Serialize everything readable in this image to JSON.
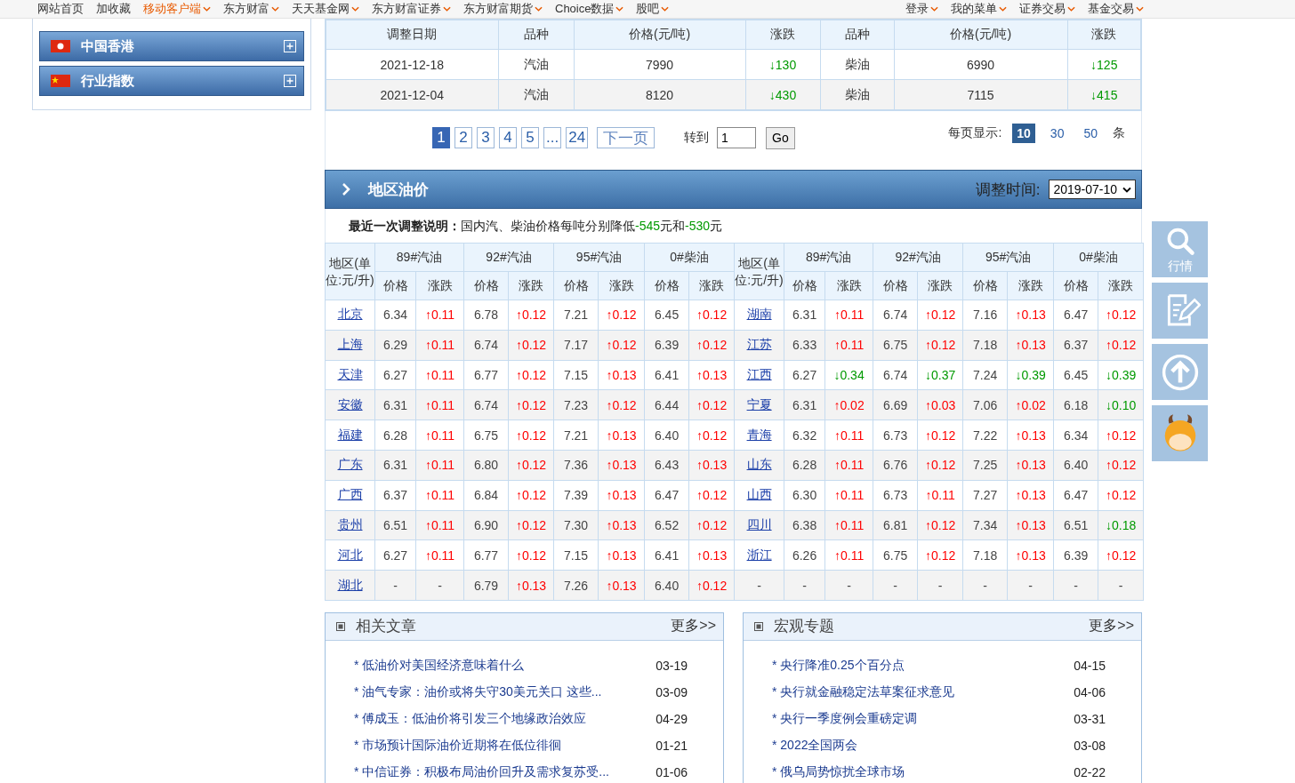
{
  "nav": {
    "left": [
      {
        "label": "网站首页",
        "caret": false,
        "highlight": false
      },
      {
        "label": "加收藏",
        "caret": false,
        "highlight": false
      },
      {
        "label": "移动客户端",
        "caret": true,
        "highlight": true
      },
      {
        "label": "东方财富",
        "caret": true,
        "highlight": false
      },
      {
        "label": "天天基金网",
        "caret": true,
        "highlight": false
      },
      {
        "label": "东方财富证券",
        "caret": true,
        "highlight": false
      },
      {
        "label": "东方财富期货",
        "caret": true,
        "highlight": false
      },
      {
        "label": "Choice数据",
        "caret": true,
        "highlight": false
      },
      {
        "label": "股吧",
        "caret": true,
        "highlight": false
      }
    ],
    "right": [
      {
        "label": "登录",
        "caret": true,
        "highlight": false
      },
      {
        "label": "我的菜单",
        "caret": true,
        "highlight": false
      },
      {
        "label": "证券交易",
        "caret": true,
        "highlight": false
      },
      {
        "label": "基金交易",
        "caret": true,
        "highlight": false
      }
    ]
  },
  "sidebar": {
    "items": [
      {
        "label": "中国香港",
        "kind": "hk"
      },
      {
        "label": "行业指数",
        "kind": "cn"
      }
    ]
  },
  "price_history": {
    "columns": [
      "调整日期",
      "品种",
      "价格(元/吨)",
      "涨跌",
      "品种",
      "价格(元/吨)",
      "涨跌"
    ],
    "rows": [
      {
        "cells": [
          {
            "text": "2021-12-18"
          },
          {
            "text": "汽油"
          },
          {
            "text": "7990"
          },
          {
            "text": "↓130",
            "kind": "down"
          },
          {
            "text": "柴油"
          },
          {
            "text": "6990"
          },
          {
            "text": "↓125",
            "kind": "down"
          }
        ]
      },
      {
        "cells": [
          {
            "text": "2021-12-04"
          },
          {
            "text": "汽油"
          },
          {
            "text": "8120"
          },
          {
            "text": "↓430",
            "kind": "down"
          },
          {
            "text": "柴油"
          },
          {
            "text": "7115"
          },
          {
            "text": "↓415",
            "kind": "down"
          }
        ]
      }
    ]
  },
  "pagination": {
    "pages": [
      {
        "label": "1",
        "selected": true
      },
      {
        "label": "2",
        "selected": false
      },
      {
        "label": "3",
        "selected": false
      },
      {
        "label": "4",
        "selected": false
      },
      {
        "label": "5",
        "selected": false
      },
      {
        "label": "...",
        "selected": false
      },
      {
        "label": "24",
        "selected": false
      }
    ],
    "next": "下一页",
    "goto_label": "转到",
    "goto_value": "1",
    "go": "Go",
    "per_page_label": "每页显示:",
    "per_page": [
      {
        "label": "10",
        "selected": true
      },
      {
        "label": "30",
        "selected": false
      },
      {
        "label": "50",
        "selected": false
      }
    ],
    "per_page_unit": "条"
  },
  "regional": {
    "title": "地区油价",
    "date_label": "调整时间:",
    "date_value": "2019-07-10",
    "note": {
      "label": "最近一次调整说明：",
      "parts": [
        {
          "text": "国内汽、柴油价格每吨分别降低",
          "kind": "plain"
        },
        {
          "text": "-545",
          "kind": "down"
        },
        {
          "text": "元和",
          "kind": "plain"
        },
        {
          "text": "-530",
          "kind": "down"
        },
        {
          "text": "元",
          "kind": "plain"
        }
      ]
    },
    "headers": [
      {
        "region": "地区(单位:元/升)",
        "fuels": [
          {
            "name": "89#汽油",
            "price": "价格",
            "change": "涨跌"
          },
          {
            "name": "92#汽油",
            "price": "价格",
            "change": "涨跌"
          },
          {
            "name": "95#汽油",
            "price": "价格",
            "change": "涨跌"
          },
          {
            "name": "0#柴油",
            "price": "价格",
            "change": "涨跌"
          }
        ]
      },
      {
        "region": "地区(单位:元/升)",
        "fuels": [
          {
            "name": "89#汽油",
            "price": "价格",
            "change": "涨跌"
          },
          {
            "name": "92#汽油",
            "price": "价格",
            "change": "涨跌"
          },
          {
            "name": "95#汽油",
            "price": "价格",
            "change": "涨跌"
          },
          {
            "name": "0#柴油",
            "price": "价格",
            "change": "涨跌"
          }
        ]
      }
    ],
    "left_rows": [
      {
        "region": "北京",
        "link": true,
        "prices": [
          "6.34",
          "6.78",
          "7.21",
          "6.45"
        ],
        "changes": [
          {
            "text": "↑0.11",
            "kind": "up"
          },
          {
            "text": "↑0.12",
            "kind": "up"
          },
          {
            "text": "↑0.12",
            "kind": "up"
          },
          {
            "text": "↑0.12",
            "kind": "up"
          }
        ]
      },
      {
        "region": "上海",
        "link": true,
        "prices": [
          "6.29",
          "6.74",
          "7.17",
          "6.39"
        ],
        "changes": [
          {
            "text": "↑0.11",
            "kind": "up"
          },
          {
            "text": "↑0.12",
            "kind": "up"
          },
          {
            "text": "↑0.12",
            "kind": "up"
          },
          {
            "text": "↑0.12",
            "kind": "up"
          }
        ]
      },
      {
        "region": "天津",
        "link": true,
        "prices": [
          "6.27",
          "6.77",
          "7.15",
          "6.41"
        ],
        "changes": [
          {
            "text": "↑0.11",
            "kind": "up"
          },
          {
            "text": "↑0.12",
            "kind": "up"
          },
          {
            "text": "↑0.13",
            "kind": "up"
          },
          {
            "text": "↑0.13",
            "kind": "up"
          }
        ]
      },
      {
        "region": "安徽",
        "link": true,
        "prices": [
          "6.31",
          "6.74",
          "7.23",
          "6.44"
        ],
        "changes": [
          {
            "text": "↑0.11",
            "kind": "up"
          },
          {
            "text": "↑0.12",
            "kind": "up"
          },
          {
            "text": "↑0.12",
            "kind": "up"
          },
          {
            "text": "↑0.12",
            "kind": "up"
          }
        ]
      },
      {
        "region": "福建",
        "link": true,
        "prices": [
          "6.28",
          "6.75",
          "7.21",
          "6.40"
        ],
        "changes": [
          {
            "text": "↑0.11",
            "kind": "up"
          },
          {
            "text": "↑0.12",
            "kind": "up"
          },
          {
            "text": "↑0.13",
            "kind": "up"
          },
          {
            "text": "↑0.12",
            "kind": "up"
          }
        ]
      },
      {
        "region": "广东",
        "link": true,
        "prices": [
          "6.31",
          "6.80",
          "7.36",
          "6.43"
        ],
        "changes": [
          {
            "text": "↑0.11",
            "kind": "up"
          },
          {
            "text": "↑0.12",
            "kind": "up"
          },
          {
            "text": "↑0.13",
            "kind": "up"
          },
          {
            "text": "↑0.13",
            "kind": "up"
          }
        ]
      },
      {
        "region": "广西",
        "link": true,
        "prices": [
          "6.37",
          "6.84",
          "7.39",
          "6.47"
        ],
        "changes": [
          {
            "text": "↑0.11",
            "kind": "up"
          },
          {
            "text": "↑0.12",
            "kind": "up"
          },
          {
            "text": "↑0.13",
            "kind": "up"
          },
          {
            "text": "↑0.12",
            "kind": "up"
          }
        ]
      },
      {
        "region": "贵州",
        "link": true,
        "prices": [
          "6.51",
          "6.90",
          "7.30",
          "6.52"
        ],
        "changes": [
          {
            "text": "↑0.11",
            "kind": "up"
          },
          {
            "text": "↑0.12",
            "kind": "up"
          },
          {
            "text": "↑0.13",
            "kind": "up"
          },
          {
            "text": "↑0.12",
            "kind": "up"
          }
        ]
      },
      {
        "region": "河北",
        "link": true,
        "prices": [
          "6.27",
          "6.77",
          "7.15",
          "6.41"
        ],
        "changes": [
          {
            "text": "↑0.11",
            "kind": "up"
          },
          {
            "text": "↑0.12",
            "kind": "up"
          },
          {
            "text": "↑0.13",
            "kind": "up"
          },
          {
            "text": "↑0.13",
            "kind": "up"
          }
        ]
      },
      {
        "region": "湖北",
        "link": true,
        "prices": [
          "-",
          "6.79",
          "7.26",
          "6.40"
        ],
        "changes": [
          {
            "text": "-",
            "kind": "flat"
          },
          {
            "text": "↑0.13",
            "kind": "up"
          },
          {
            "text": "↑0.13",
            "kind": "up"
          },
          {
            "text": "↑0.12",
            "kind": "up"
          }
        ]
      }
    ],
    "right_rows": [
      {
        "region": "湖南",
        "link": true,
        "prices": [
          "6.31",
          "6.74",
          "7.16",
          "6.47"
        ],
        "changes": [
          {
            "text": "↑0.11",
            "kind": "up"
          },
          {
            "text": "↑0.12",
            "kind": "up"
          },
          {
            "text": "↑0.13",
            "kind": "up"
          },
          {
            "text": "↑0.12",
            "kind": "up"
          }
        ]
      },
      {
        "region": "江苏",
        "link": true,
        "prices": [
          "6.33",
          "6.75",
          "7.18",
          "6.37"
        ],
        "changes": [
          {
            "text": "↑0.11",
            "kind": "up"
          },
          {
            "text": "↑0.12",
            "kind": "up"
          },
          {
            "text": "↑0.13",
            "kind": "up"
          },
          {
            "text": "↑0.12",
            "kind": "up"
          }
        ]
      },
      {
        "region": "江西",
        "link": true,
        "prices": [
          "6.27",
          "6.74",
          "7.24",
          "6.45"
        ],
        "changes": [
          {
            "text": "↓0.34",
            "kind": "down"
          },
          {
            "text": "↓0.37",
            "kind": "down"
          },
          {
            "text": "↓0.39",
            "kind": "down"
          },
          {
            "text": "↓0.39",
            "kind": "down"
          }
        ]
      },
      {
        "region": "宁夏",
        "link": true,
        "prices": [
          "6.31",
          "6.69",
          "7.06",
          "6.18"
        ],
        "changes": [
          {
            "text": "↑0.02",
            "kind": "up"
          },
          {
            "text": "↑0.03",
            "kind": "up"
          },
          {
            "text": "↑0.02",
            "kind": "up"
          },
          {
            "text": "↓0.10",
            "kind": "down"
          }
        ]
      },
      {
        "region": "青海",
        "link": true,
        "prices": [
          "6.32",
          "6.73",
          "7.22",
          "6.34"
        ],
        "changes": [
          {
            "text": "↑0.11",
            "kind": "up"
          },
          {
            "text": "↑0.12",
            "kind": "up"
          },
          {
            "text": "↑0.13",
            "kind": "up"
          },
          {
            "text": "↑0.12",
            "kind": "up"
          }
        ]
      },
      {
        "region": "山东",
        "link": true,
        "prices": [
          "6.28",
          "6.76",
          "7.25",
          "6.40"
        ],
        "changes": [
          {
            "text": "↑0.11",
            "kind": "up"
          },
          {
            "text": "↑0.12",
            "kind": "up"
          },
          {
            "text": "↑0.13",
            "kind": "up"
          },
          {
            "text": "↑0.12",
            "kind": "up"
          }
        ]
      },
      {
        "region": "山西",
        "link": true,
        "prices": [
          "6.30",
          "6.73",
          "7.27",
          "6.47"
        ],
        "changes": [
          {
            "text": "↑0.11",
            "kind": "up"
          },
          {
            "text": "↑0.11",
            "kind": "up"
          },
          {
            "text": "↑0.13",
            "kind": "up"
          },
          {
            "text": "↑0.12",
            "kind": "up"
          }
        ]
      },
      {
        "region": "四川",
        "link": true,
        "prices": [
          "6.38",
          "6.81",
          "7.34",
          "6.51"
        ],
        "changes": [
          {
            "text": "↑0.11",
            "kind": "up"
          },
          {
            "text": "↑0.12",
            "kind": "up"
          },
          {
            "text": "↑0.13",
            "kind": "up"
          },
          {
            "text": "↓0.18",
            "kind": "down"
          }
        ]
      },
      {
        "region": "浙江",
        "link": true,
        "prices": [
          "6.26",
          "6.75",
          "7.18",
          "6.39"
        ],
        "changes": [
          {
            "text": "↑0.11",
            "kind": "up"
          },
          {
            "text": "↑0.12",
            "kind": "up"
          },
          {
            "text": "↑0.13",
            "kind": "up"
          },
          {
            "text": "↑0.12",
            "kind": "up"
          }
        ]
      },
      {
        "region": "-",
        "link": false,
        "prices": [
          "-",
          "-",
          "-",
          "-"
        ],
        "changes": [
          {
            "text": "-",
            "kind": "flat"
          },
          {
            "text": "-",
            "kind": "flat"
          },
          {
            "text": "-",
            "kind": "flat"
          },
          {
            "text": "-",
            "kind": "flat"
          }
        ]
      }
    ]
  },
  "panels": [
    {
      "title": "相关文章",
      "more": "更多>>",
      "articles": [
        {
          "title": "* 低油价对美国经济意味着什么",
          "date": "03-19"
        },
        {
          "title": "* 油气专家：油价或将失守30美元关口 这些...",
          "date": "03-09"
        },
        {
          "title": "* 傅成玉：低油价将引发三个地缘政治效应",
          "date": "04-29"
        },
        {
          "title": "* 市场预计国际油价近期将在低位徘徊",
          "date": "01-21"
        },
        {
          "title": "* 中信证券：积极布局油价回升及需求复苏受...",
          "date": "01-06"
        }
      ]
    },
    {
      "title": "宏观专题",
      "more": "更多>>",
      "articles": [
        {
          "title": "* 央行降准0.25个百分点",
          "date": "04-15"
        },
        {
          "title": "* 央行就金融稳定法草案征求意见",
          "date": "04-06"
        },
        {
          "title": "* 央行一季度例会重磅定调",
          "date": "03-31"
        },
        {
          "title": "* 2022全国两会",
          "date": "03-08"
        },
        {
          "title": "* 俄乌局势惊扰全球市场",
          "date": "02-22"
        }
      ]
    }
  ],
  "rail": [
    {
      "kind": "search",
      "label": "行情"
    },
    {
      "kind": "edit"
    },
    {
      "kind": "top"
    },
    {
      "kind": "mascot"
    }
  ]
}
